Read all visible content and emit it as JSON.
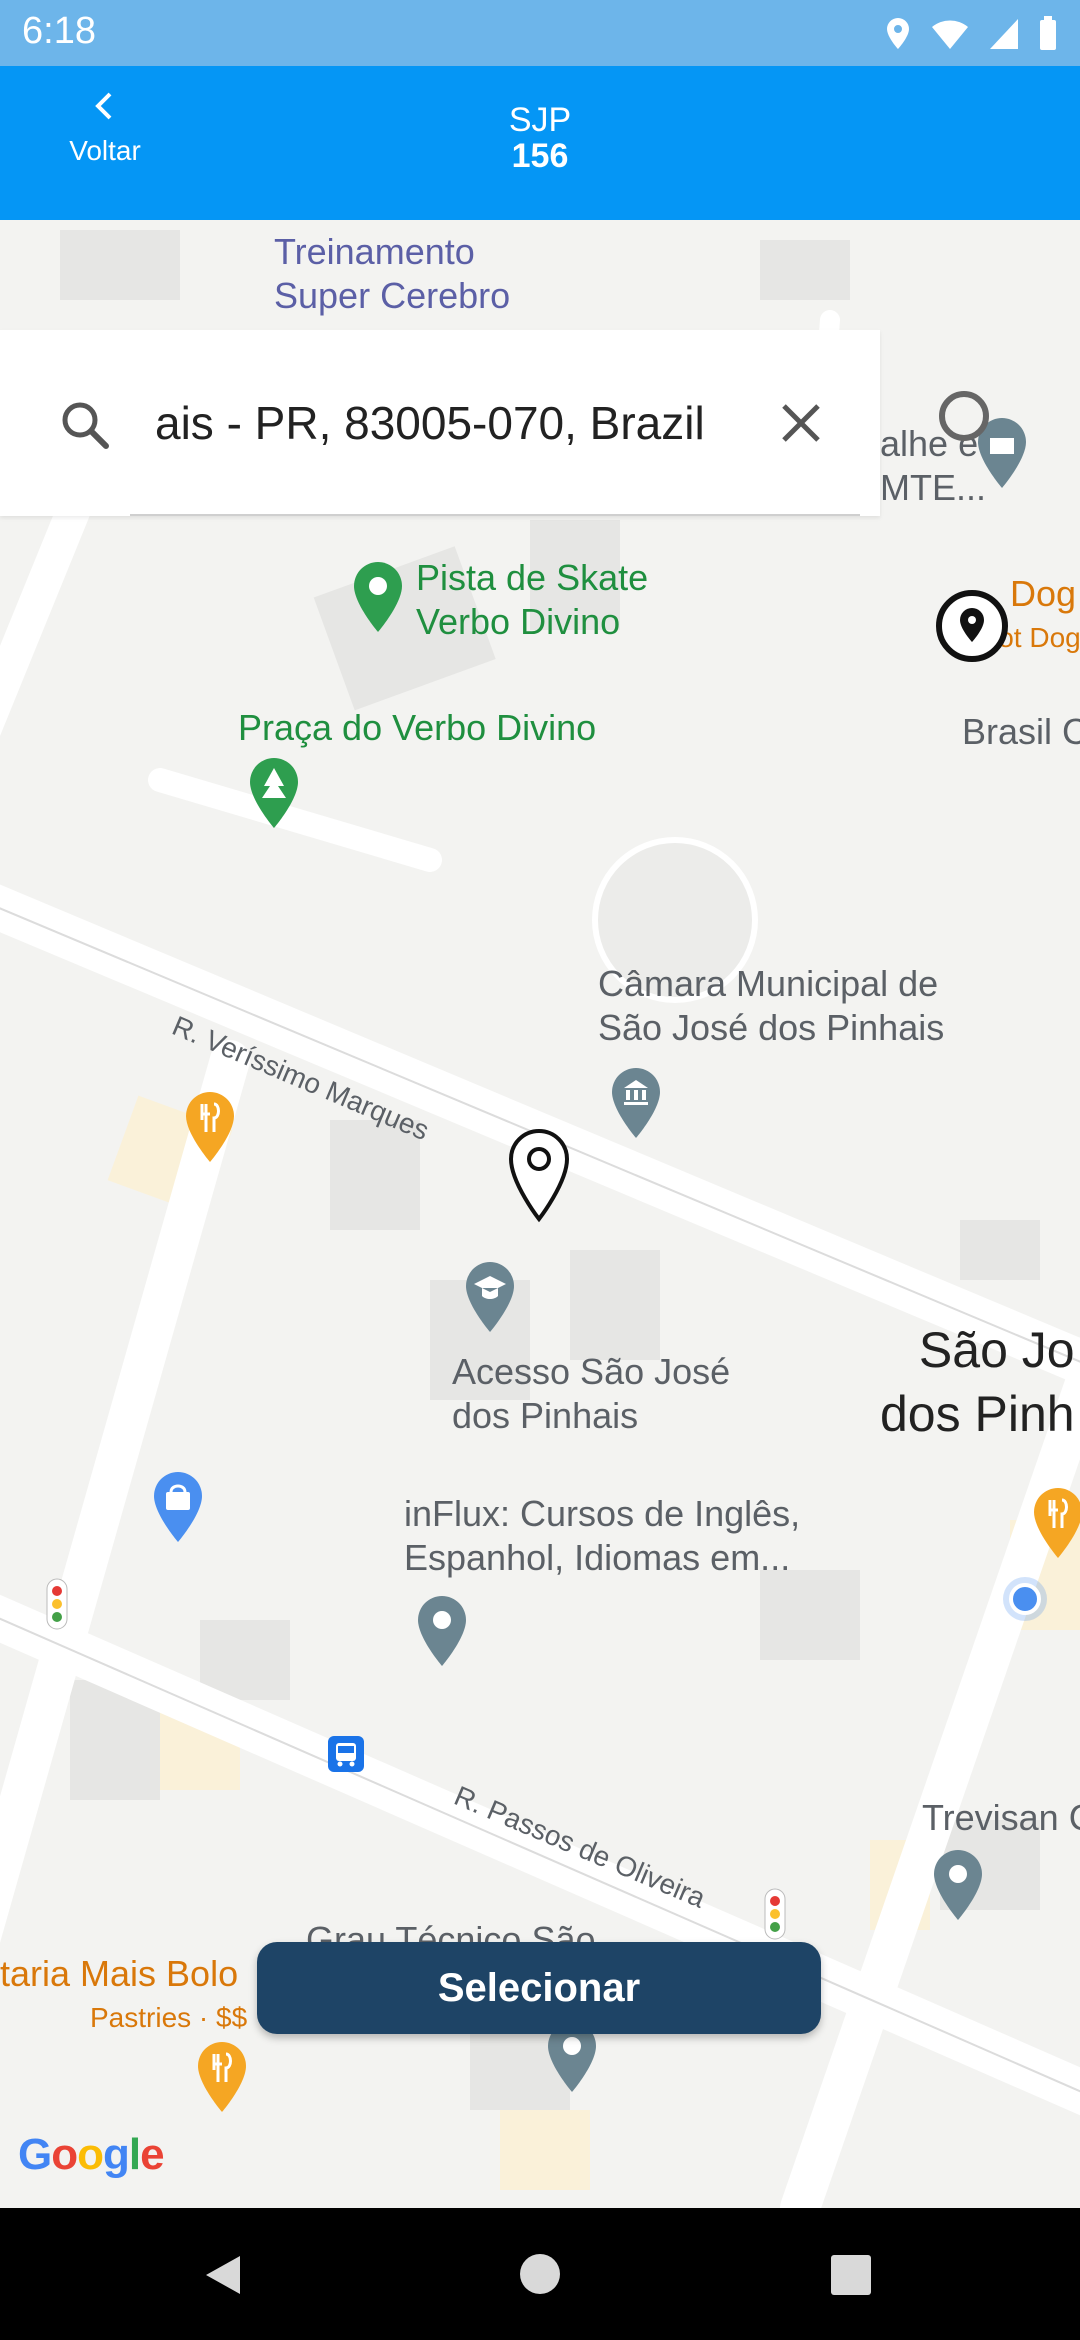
{
  "status_bar": {
    "time": "6:18"
  },
  "header": {
    "back_label": "Voltar",
    "title_line1": "SJP",
    "title_line2": "156"
  },
  "search": {
    "value": "ais - PR, 83005-070, Brazil"
  },
  "map": {
    "labels": {
      "treinamento": "Treinamento\nSuper Cerebro",
      "skate": "Pista de Skate\nVerbo Divino",
      "praca": "Praça do Verbo Divino",
      "camara": "Câmara Municipal de\nSão José dos Pinhais",
      "acesso": "Acesso São José\ndos Pinhais",
      "influx": "inFlux: Cursos de Inglês,\nEspanhol, Idiomas em...",
      "sao_jose": "São Jo\ndos Pinh",
      "trevisan": "Trevisan C",
      "dog": "Dog",
      "hot_dog": "Hot Dog",
      "brasil": "Brasil C",
      "alhe": "alhe e\nMTE...",
      "grau": "Grau Técnico São",
      "mais_bolo": "taria Mais Bolo",
      "pastries": "Pastries · $$",
      "google": "Google"
    },
    "streets": {
      "verissimo": "R. Veríssimo Marques",
      "passos": "R. Passos de Oliveira"
    }
  },
  "select_button": {
    "label": "Selecionar"
  },
  "colors": {
    "header": "#0596f5",
    "status_bar": "#6db5ea",
    "button": "#1e4466"
  }
}
